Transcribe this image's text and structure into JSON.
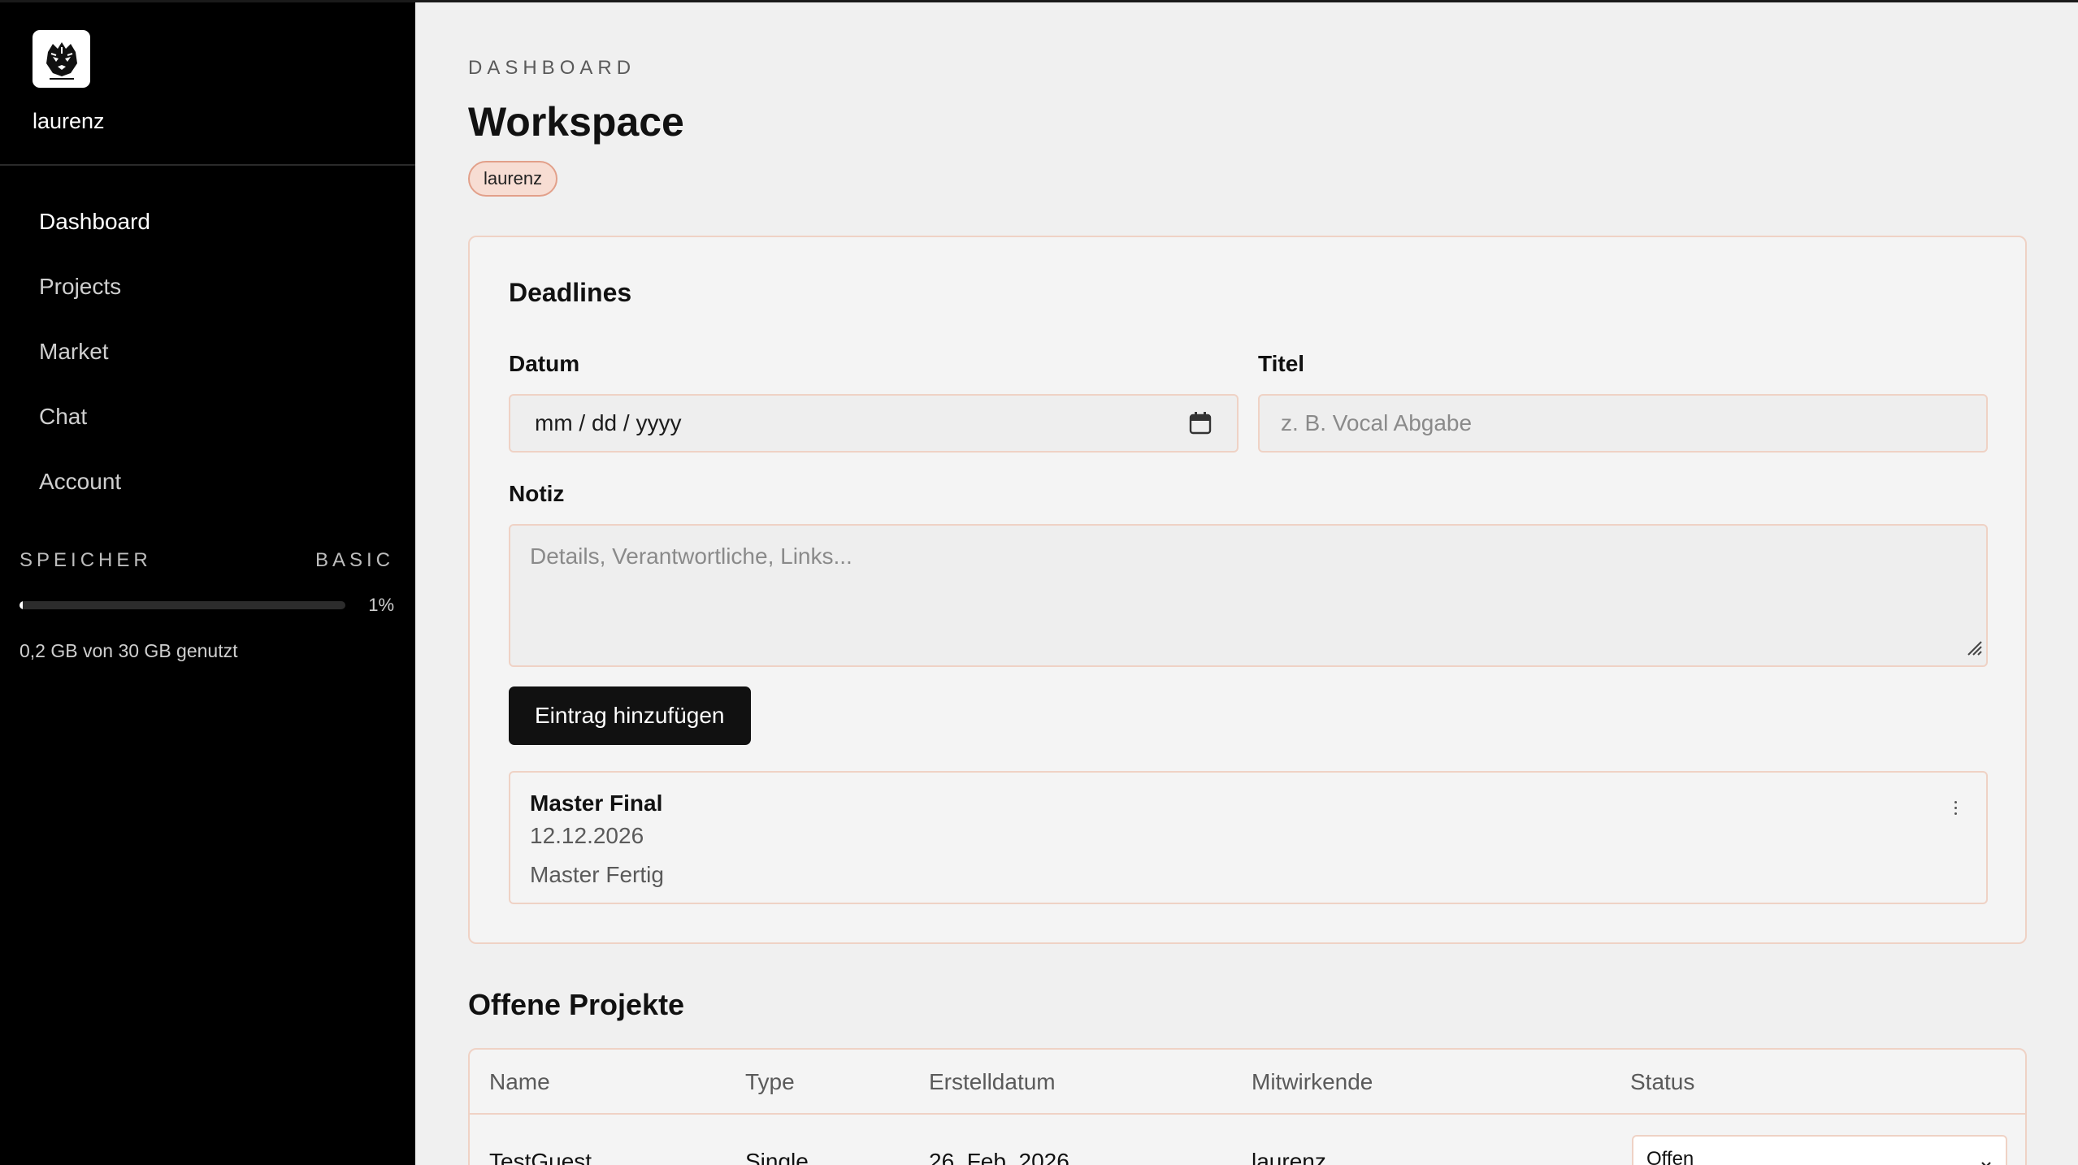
{
  "sidebar": {
    "username": "laurenz",
    "nav": [
      {
        "label": "Dashboard",
        "active": true
      },
      {
        "label": "Projects",
        "active": false
      },
      {
        "label": "Market",
        "active": false
      },
      {
        "label": "Chat",
        "active": false
      },
      {
        "label": "Account",
        "active": false
      }
    ],
    "storage": {
      "label": "SPEICHER",
      "plan": "BASIC",
      "percent_text": "1%",
      "used_fraction": 0.01,
      "used_text": "0,2 GB von 30 GB genutzt"
    }
  },
  "header": {
    "eyebrow": "DASHBOARD",
    "title": "Workspace",
    "user_chip": "laurenz"
  },
  "deadlines": {
    "title": "Deadlines",
    "date_label": "Datum",
    "date_value": "mm / dd / yyyy",
    "title_label": "Titel",
    "title_placeholder": "z. B. Vocal Abgabe",
    "note_label": "Notiz",
    "note_placeholder": "Details, Verantwortliche, Links...",
    "add_button": "Eintrag hinzufügen",
    "entries": [
      {
        "title": "Master Final",
        "date": "12.12.2026",
        "note": "Master Fertig"
      }
    ]
  },
  "projects": {
    "title": "Offene Projekte",
    "columns": [
      "Name",
      "Type",
      "Erstelldatum",
      "Mitwirkende",
      "Status"
    ],
    "rows": [
      {
        "name": "TestGuest",
        "type": "Single",
        "created": "26. Feb. 2026",
        "contributors": "laurenz",
        "status": "Offen"
      }
    ]
  },
  "colors": {
    "accent_border": "#efd2c5",
    "chip_bg": "#f7ddd3",
    "sidebar_bg": "#000000",
    "button_bg": "#111111"
  },
  "icons": [
    "tiger-logo-icon",
    "calendar-icon",
    "resize-grip-icon",
    "more-vertical-icon",
    "chevron-down-icon"
  ]
}
